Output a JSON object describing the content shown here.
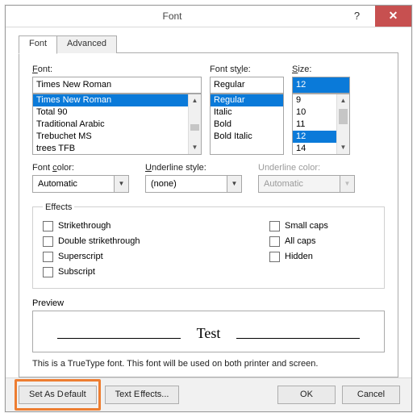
{
  "titlebar": {
    "title": "Font"
  },
  "tabs": {
    "font": "Font",
    "advanced": "Advanced"
  },
  "labels": {
    "font": "Font:",
    "fontstyle": "Font style:",
    "size": "Size:",
    "fontcolor": "Font color:",
    "underlinestyle": "Underline style:",
    "underlinecolor": "Underline color:",
    "effects": "Effects",
    "preview": "Preview"
  },
  "font": {
    "value": "Times New Roman",
    "items": [
      "Times New Roman",
      "Total 90",
      "Traditional Arabic",
      "Trebuchet MS",
      "trees TFB"
    ],
    "selected": "Times New Roman"
  },
  "style": {
    "value": "Regular",
    "items": [
      "Regular",
      "Italic",
      "Bold",
      "Bold Italic"
    ],
    "selected": "Regular"
  },
  "size": {
    "value": "12",
    "items": [
      "9",
      "10",
      "11",
      "12",
      "14"
    ],
    "selected": "12"
  },
  "fontcolor": "Automatic",
  "underlinestyle": "(none)",
  "underlinecolor": "Automatic",
  "effects": {
    "strike": "Strikethrough",
    "dstrike": "Double strikethrough",
    "super": "Superscript",
    "sub": "Subscript",
    "smallcaps": "Small caps",
    "allcaps": "All caps",
    "hidden": "Hidden"
  },
  "preview_text": "Test",
  "note": "This is a TrueType font. This font will be used on both printer and screen.",
  "buttons": {
    "setdefault": "Set As Default",
    "texteffects": "Text Effects...",
    "ok": "OK",
    "cancel": "Cancel"
  }
}
